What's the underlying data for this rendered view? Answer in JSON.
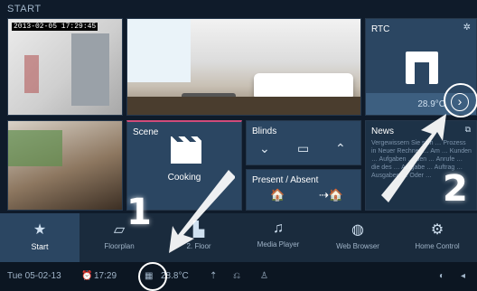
{
  "title": "START",
  "camera1": {
    "timestamp": "2013-02-05 17:29:45"
  },
  "rtc": {
    "label": "RTC",
    "dots": "• • •",
    "temp": "28.9°C",
    "next": "›",
    "gear": "✲"
  },
  "scene": {
    "label": "Scene",
    "item": "Cooking"
  },
  "blinds": {
    "label": "Blinds",
    "down": "⌄",
    "stop": "▭",
    "up": "⌃"
  },
  "presence": {
    "label": "Present / Absent",
    "present": "🏠",
    "absent": "⇢🏠"
  },
  "news": {
    "label": "News",
    "icon": "⧉",
    "text": "Vergewissern Sie sich … Prozess in Neuer Rechner … Am … Kunden … Aufgaben … den … Anrufe … die des … Aufgabe … Auftrag … Ausgaben … Oder …"
  },
  "nav": {
    "items": [
      {
        "label": "Start",
        "icon": "★"
      },
      {
        "label": "Floorplan",
        "icon": "▱"
      },
      {
        "label": "2. Floor",
        "icon": "▙"
      },
      {
        "label": "Media Player",
        "icon": "♫"
      },
      {
        "label": "Web Browser",
        "icon": "◍"
      },
      {
        "label": "Home Control",
        "icon": "⚙"
      }
    ]
  },
  "status": {
    "date": "Tue 05-02-13",
    "time": "17:29",
    "temp": "28.8°C",
    "icons": [
      "clock-icon",
      "meter-icon",
      "pin-icon",
      "link-icon",
      "person-icon",
      "settings-icon",
      "speaker-icon"
    ]
  },
  "annotations": {
    "one": "1",
    "two": "2"
  }
}
